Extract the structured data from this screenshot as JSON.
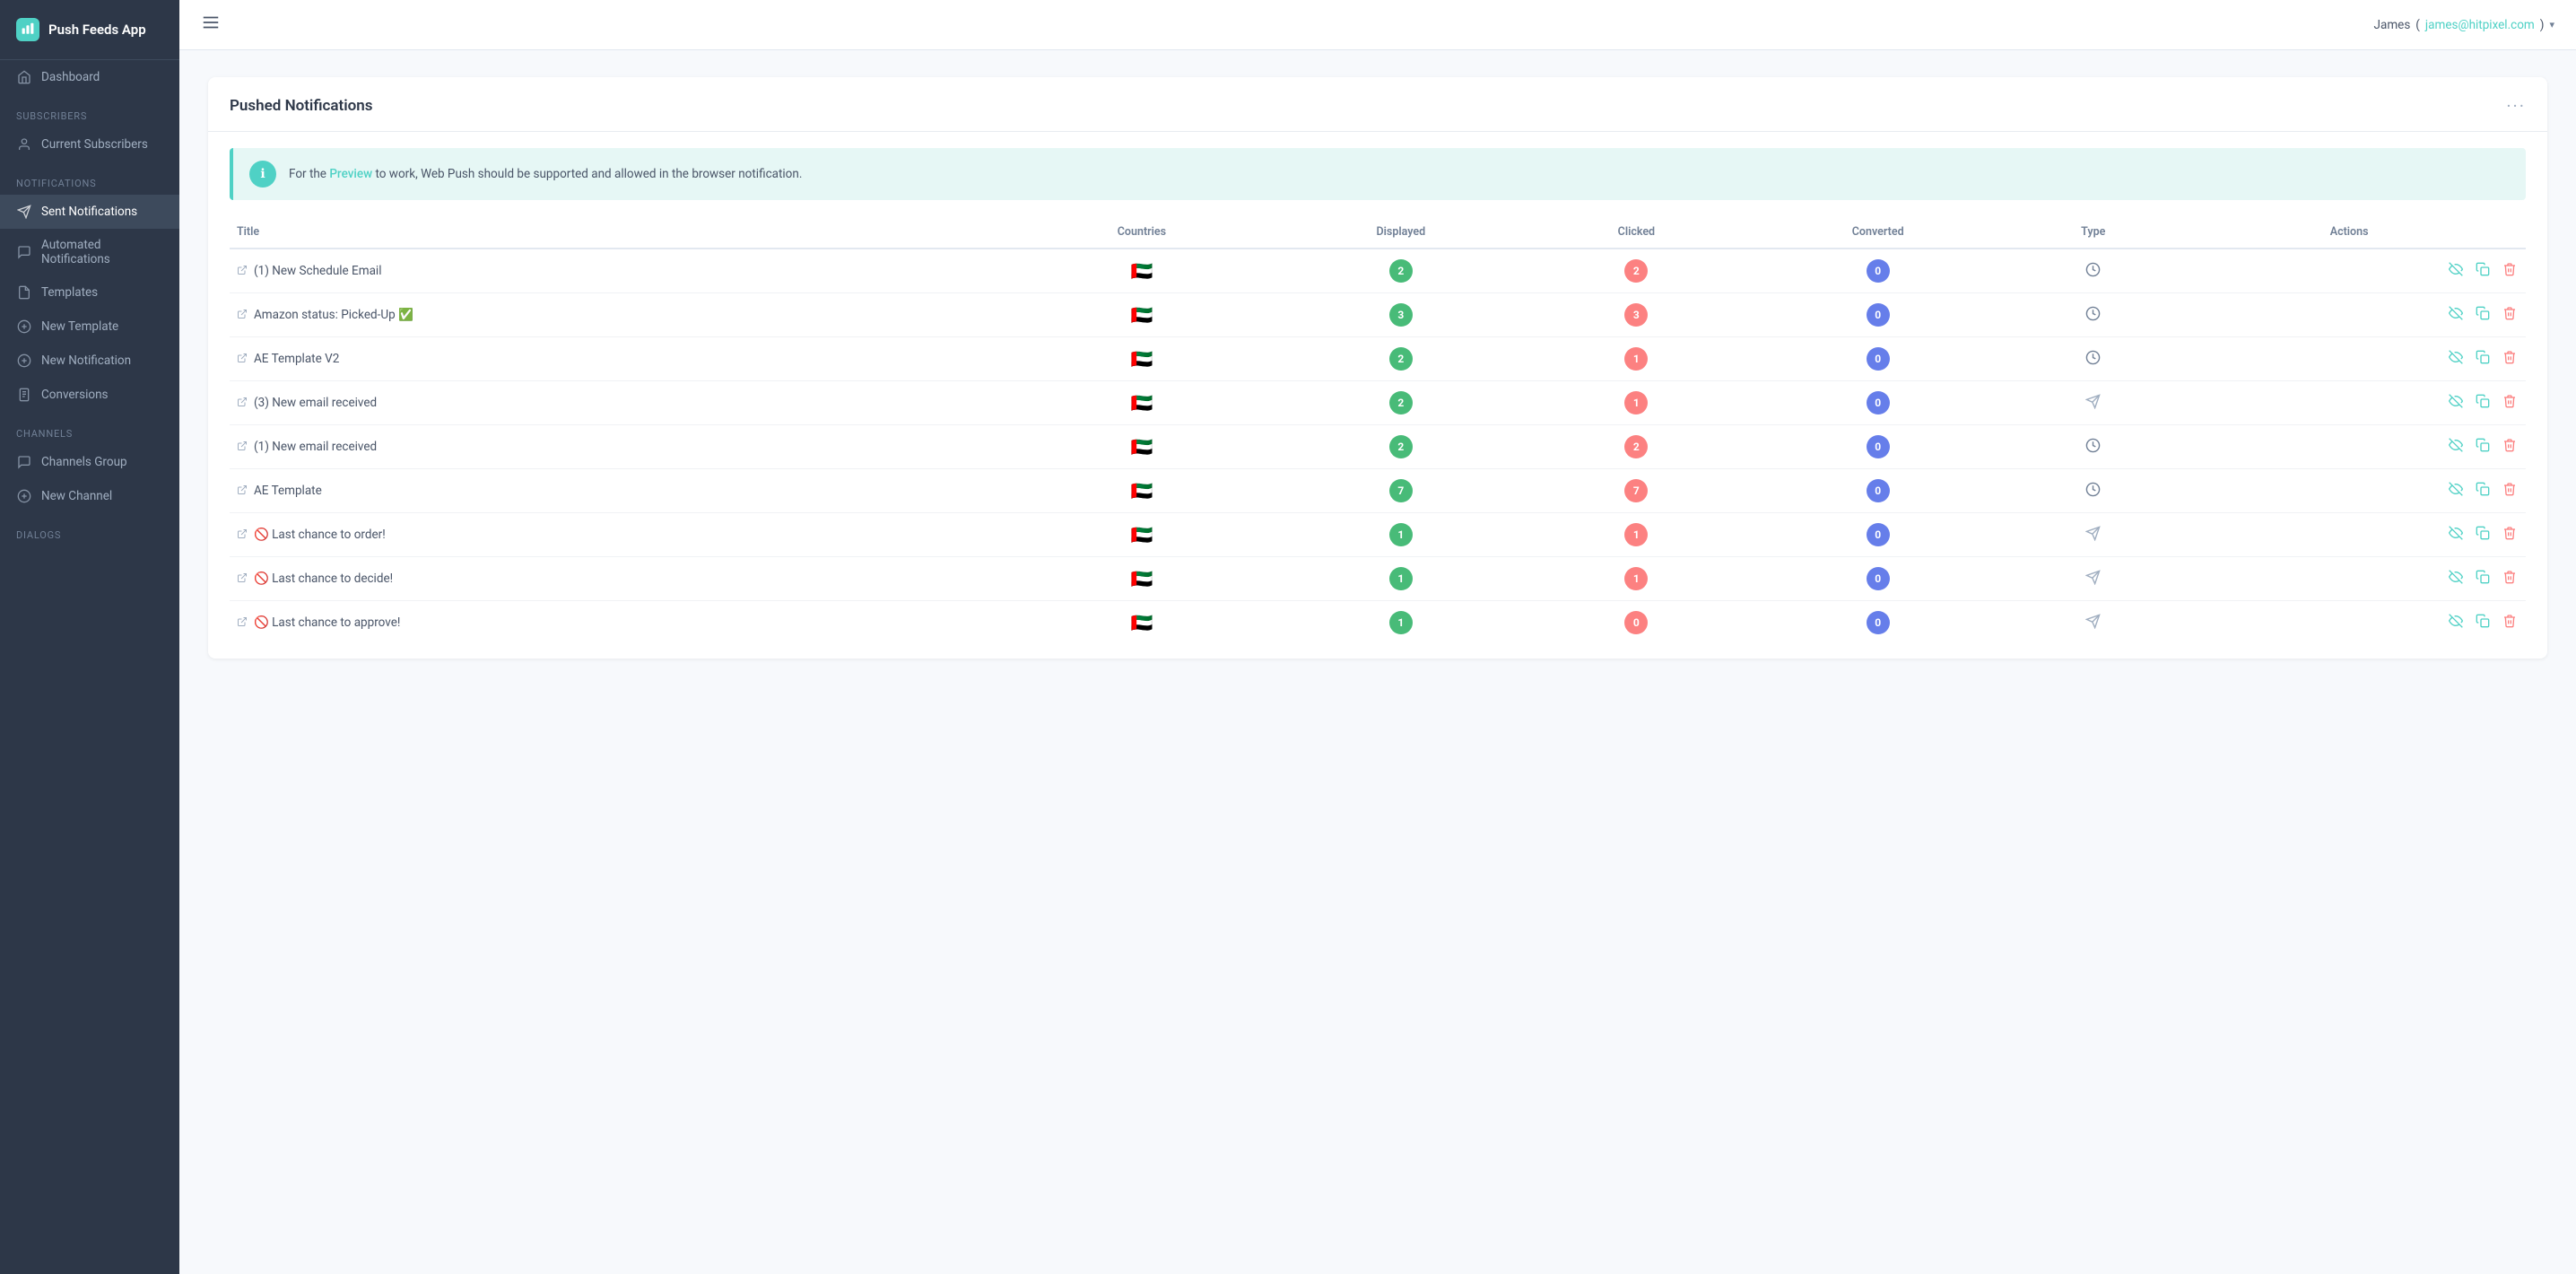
{
  "app": {
    "name": "Push Feeds App",
    "logo_icon": "📡"
  },
  "topbar": {
    "user_name": "James",
    "user_email": "james@hitpixel.com",
    "menu_icon": "≡"
  },
  "sidebar": {
    "sections": [
      {
        "label": "",
        "items": [
          {
            "id": "dashboard",
            "label": "Dashboard",
            "icon": "🏠"
          }
        ]
      },
      {
        "label": "Subscribers",
        "items": [
          {
            "id": "current-subscribers",
            "label": "Current Subscribers",
            "icon": "👤"
          }
        ]
      },
      {
        "label": "Notifications",
        "items": [
          {
            "id": "sent-notifications",
            "label": "Sent Notifications",
            "icon": "✈",
            "active": true
          },
          {
            "id": "automated-notifications",
            "label": "Automated Notifications",
            "icon": "💬"
          },
          {
            "id": "templates",
            "label": "Templates",
            "icon": "📄"
          },
          {
            "id": "new-template",
            "label": "New Template",
            "icon": "➕"
          },
          {
            "id": "new-notification",
            "label": "New Notification",
            "icon": "➕"
          },
          {
            "id": "conversions",
            "label": "Conversions",
            "icon": "📋"
          }
        ]
      },
      {
        "label": "Channels",
        "items": [
          {
            "id": "channels-group",
            "label": "Channels Group",
            "icon": "💬"
          },
          {
            "id": "new-channel",
            "label": "New Channel",
            "icon": "➕"
          }
        ]
      },
      {
        "label": "Dialogs",
        "items": []
      }
    ]
  },
  "main": {
    "card_title": "Pushed Notifications",
    "info_text_before": "For the ",
    "info_link": "Preview",
    "info_text_after": " to work, Web Push should be supported and allowed in the browser notification.",
    "table": {
      "columns": [
        "Title",
        "Countries",
        "Displayed",
        "Clicked",
        "Converted",
        "Type",
        "Actions"
      ],
      "rows": [
        {
          "title": "(1) New Schedule Email",
          "emoji": "",
          "flag": "🇦🇪",
          "displayed": 2,
          "clicked": 2,
          "converted": 0,
          "type": "clock"
        },
        {
          "title": "Amazon status: Picked-Up ✅",
          "emoji": "",
          "flag": "🇦🇪",
          "displayed": 3,
          "clicked": 3,
          "converted": 0,
          "type": "clock"
        },
        {
          "title": "AE Template V2",
          "emoji": "",
          "flag": "🇦🇪",
          "displayed": 2,
          "clicked": 1,
          "converted": 0,
          "type": "clock"
        },
        {
          "title": "(3) New email received",
          "emoji": "",
          "flag": "🇦🇪",
          "displayed": 2,
          "clicked": 1,
          "converted": 0,
          "type": "send"
        },
        {
          "title": "(1) New email received",
          "emoji": "",
          "flag": "🇦🇪",
          "displayed": 2,
          "clicked": 2,
          "converted": 0,
          "type": "clock"
        },
        {
          "title": "AE Template",
          "emoji": "",
          "flag": "🇦🇪",
          "displayed": 7,
          "clicked": 7,
          "converted": 0,
          "type": "clock"
        },
        {
          "title": "🚫 Last chance to order!",
          "emoji": "",
          "flag": "🇦🇪",
          "displayed": 1,
          "clicked": 1,
          "converted": 0,
          "type": "send"
        },
        {
          "title": "🚫 Last chance to decide!",
          "emoji": "",
          "flag": "🇦🇪",
          "displayed": 1,
          "clicked": 1,
          "converted": 0,
          "type": "send"
        },
        {
          "title": "🚫 Last chance to approve!",
          "emoji": "",
          "flag": "🇦🇪",
          "displayed": 1,
          "clicked": 0,
          "converted": 0,
          "type": "send"
        }
      ]
    }
  }
}
